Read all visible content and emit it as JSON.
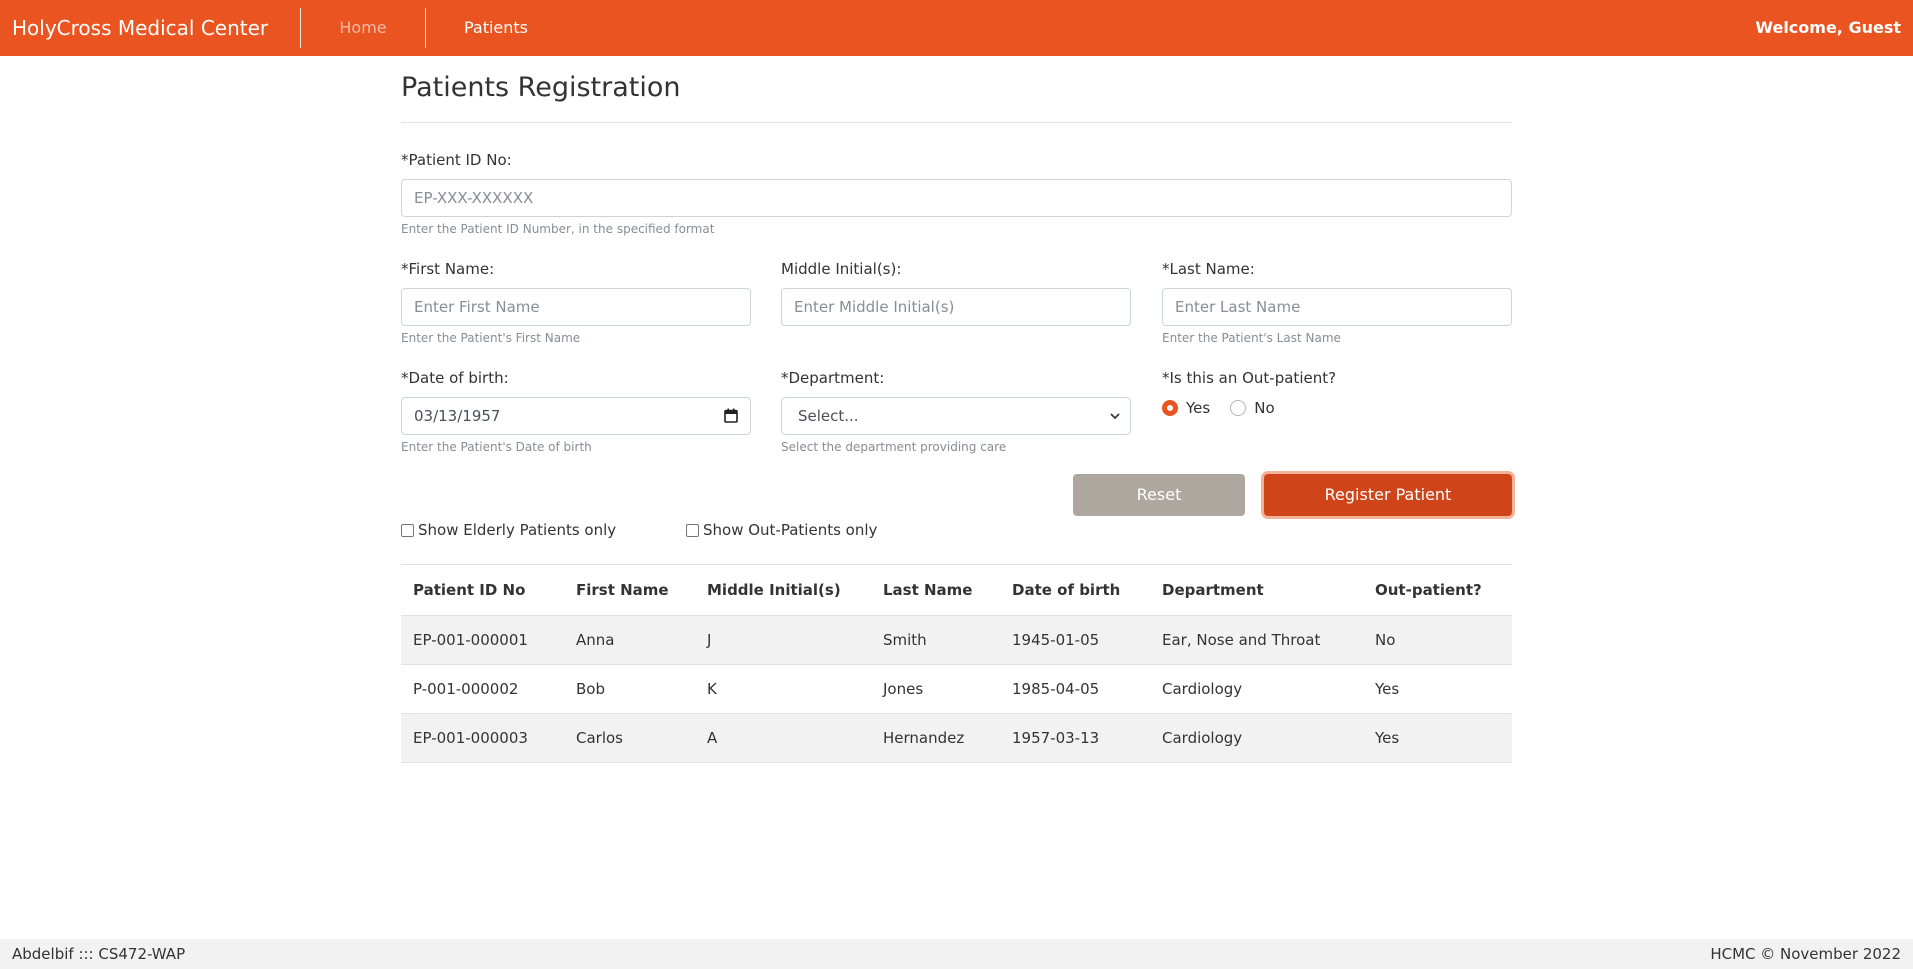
{
  "navbar": {
    "brand": "HolyCross Medical Center",
    "home": "Home",
    "patients": "Patients",
    "welcome": "Welcome, Guest",
    "color": "#e95420"
  },
  "form": {
    "title": "Patients Registration",
    "patient_id": {
      "label": "*Patient ID No:",
      "placeholder": "EP-XXX-XXXXXX",
      "help": "Enter the Patient ID Number, in the specified format"
    },
    "first_name": {
      "label": "*First Name:",
      "placeholder": "Enter First Name",
      "help": "Enter the Patient's First Name"
    },
    "middle_initials": {
      "label": "Middle Initial(s):",
      "placeholder": "Enter Middle Initial(s)"
    },
    "last_name": {
      "label": "*Last Name:",
      "placeholder": "Enter Last Name",
      "help": "Enter the Patient's Last Name"
    },
    "dob": {
      "label": "*Date of birth:",
      "value": "03/13/1957",
      "help": "Enter the Patient's Date of birth",
      "icon": "calendar-icon"
    },
    "department": {
      "label": "*Department:",
      "value": "Select...",
      "help": "Select the department providing care",
      "icon": "chevron-down-icon"
    },
    "outpatient": {
      "label": "*Is this an Out-patient?",
      "options": [
        "Yes",
        "No"
      ],
      "selected": "Yes"
    },
    "reset_label": "Reset",
    "register_label": "Register Patient"
  },
  "filters": {
    "elderly": "Show Elderly Patients only",
    "outpatients": "Show Out-Patients only"
  },
  "table": {
    "headers": [
      "Patient ID No",
      "First Name",
      "Middle Initial(s)",
      "Last Name",
      "Date of birth",
      "Department",
      "Out-patient?"
    ],
    "rows": [
      [
        "EP-001-000001",
        "Anna",
        "J",
        "Smith",
        "1945-01-05",
        "Ear, Nose and Throat",
        "No"
      ],
      [
        "P-001-000002",
        "Bob",
        "K",
        "Jones",
        "1985-04-05",
        "Cardiology",
        "Yes"
      ],
      [
        "EP-001-000003",
        "Carlos",
        "A",
        "Hernandez",
        "1957-03-13",
        "Cardiology",
        "Yes"
      ]
    ]
  },
  "footer": {
    "left": "Abdelbif ::: CS472-WAP",
    "right": "HCMC © November 2022"
  }
}
